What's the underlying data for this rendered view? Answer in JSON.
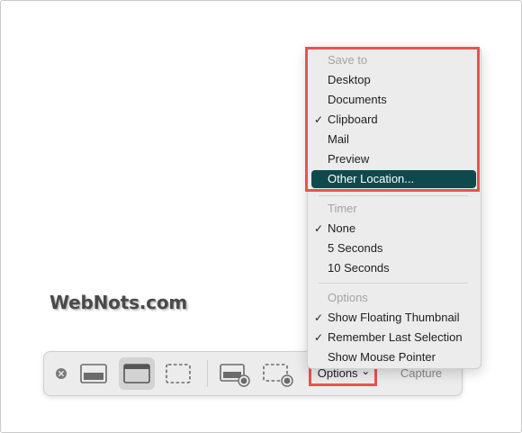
{
  "watermark": "WebNots.com",
  "menu": {
    "save_to": {
      "header": "Save to",
      "items": [
        {
          "label": "Desktop",
          "checked": false
        },
        {
          "label": "Documents",
          "checked": false
        },
        {
          "label": "Clipboard",
          "checked": true
        },
        {
          "label": "Mail",
          "checked": false
        },
        {
          "label": "Preview",
          "checked": false
        },
        {
          "label": "Other Location...",
          "checked": false,
          "highlighted": true
        }
      ]
    },
    "timer": {
      "header": "Timer",
      "items": [
        {
          "label": "None",
          "checked": true
        },
        {
          "label": "5 Seconds",
          "checked": false
        },
        {
          "label": "10 Seconds",
          "checked": false
        }
      ]
    },
    "options": {
      "header": "Options",
      "items": [
        {
          "label": "Show Floating Thumbnail",
          "checked": true
        },
        {
          "label": "Remember Last Selection",
          "checked": true
        },
        {
          "label": "Show Mouse Pointer",
          "checked": false
        }
      ]
    },
    "check_glyph": "✓"
  },
  "toolbar": {
    "options_label": "Options",
    "options_chevron": "⌄",
    "capture_label": "Capture",
    "icons": [
      "close-icon",
      "capture-entire-screen-icon",
      "capture-window-icon",
      "capture-selection-icon",
      "record-screen-icon",
      "record-selection-icon"
    ]
  },
  "colors": {
    "highlight_border": "#e6544f",
    "menu_selection": "#0e4a4d",
    "menu_background": "#ececec"
  }
}
